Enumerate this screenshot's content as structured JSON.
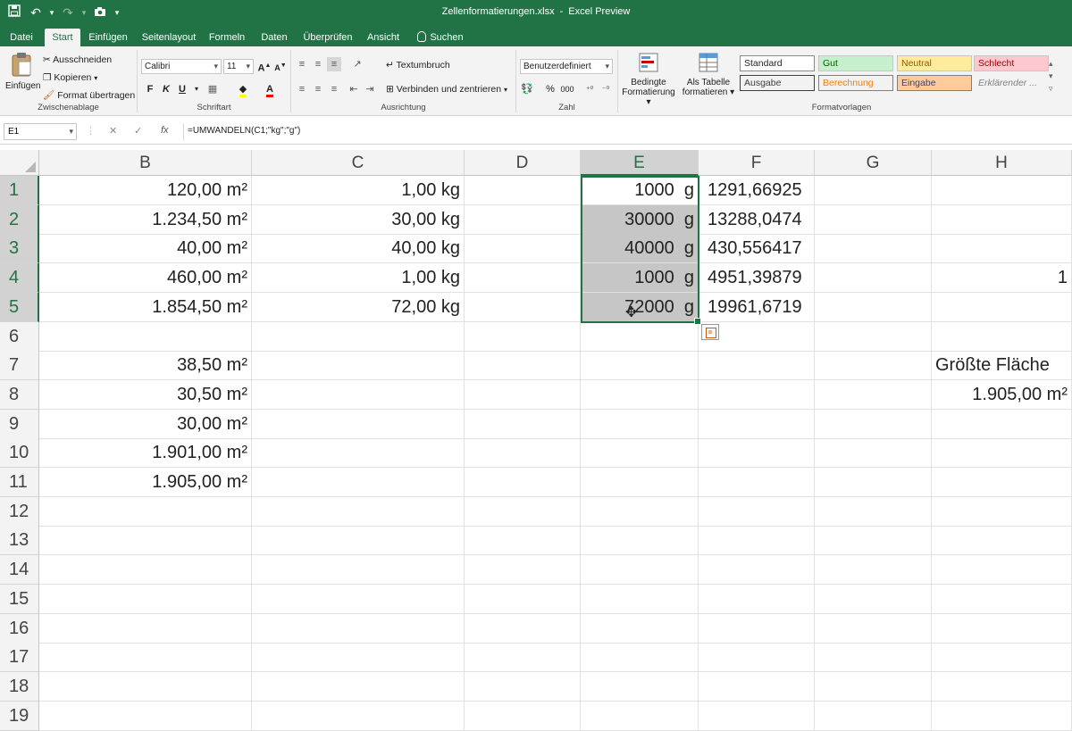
{
  "titlebar": {
    "file": "Zellenformatierungen.xlsx",
    "sep": "-",
    "app": "Excel Preview"
  },
  "tabs": [
    "Datei",
    "Start",
    "Einfügen",
    "Seitenlayout",
    "Formeln",
    "Daten",
    "Überprüfen",
    "Ansicht",
    "Suchen"
  ],
  "ribbon": {
    "clipboard": {
      "paste": "Einfügen",
      "cut": "Ausschneiden",
      "copy": "Kopieren",
      "painter": "Format übertragen",
      "label": "Zwischenablage"
    },
    "font": {
      "name": "Calibri",
      "size": "11",
      "bold": "F",
      "italic": "K",
      "underline": "U",
      "label": "Schriftart"
    },
    "alignment": {
      "wrap": "Textumbruch",
      "merge": "Verbinden und zentrieren",
      "label": "Ausrichtung"
    },
    "number": {
      "format": "Benutzerdefiniert",
      "percent": "%",
      "thousands": "000",
      "label": "Zahl"
    },
    "styles": {
      "conditional": [
        "Bedingte",
        "Formatierung"
      ],
      "table": [
        "Als Tabelle",
        "formatieren"
      ],
      "items": [
        {
          "label": "Standard",
          "bg": "#ffffff",
          "fg": "#222222",
          "border": "#8a8a8a"
        },
        {
          "label": "Gut",
          "bg": "#c6efce",
          "fg": "#006100",
          "border": "#c6c6c6"
        },
        {
          "label": "Neutral",
          "bg": "#ffeb9c",
          "fg": "#9c5700",
          "border": "#c6c6c6"
        },
        {
          "label": "Schlecht",
          "bg": "#ffc7ce",
          "fg": "#9c0006",
          "border": "#c6c6c6"
        },
        {
          "label": "Ausgabe",
          "bg": "#f2f2f2",
          "fg": "#3f3f3f",
          "border": "#3f3f3f"
        },
        {
          "label": "Berechnung",
          "bg": "#f2f2f2",
          "fg": "#fa7d00",
          "border": "#7f7f7f"
        },
        {
          "label": "Eingabe",
          "bg": "#ffcc99",
          "fg": "#3f3f76",
          "border": "#7f7f7f"
        },
        {
          "label": "Erklärender ...",
          "bg": "#f3f3f3",
          "fg": "#7f7f7f",
          "border": "#f3f3f3"
        }
      ],
      "label": "Formatvorlagen"
    }
  },
  "formula_bar": {
    "cell_ref": "E1",
    "cancel": "✕",
    "enter": "✓",
    "fx": "fx",
    "formula": "=UMWANDELN(C1;\"kg\";\"g\")"
  },
  "columns": [
    "B",
    "C",
    "D",
    "E",
    "F",
    "G",
    "H"
  ],
  "rows": [
    "1",
    "2",
    "3",
    "4",
    "5",
    "6",
    "7",
    "8",
    "9",
    "10",
    "11",
    "12",
    "13",
    "14",
    "15",
    "16",
    "17",
    "18",
    "19"
  ],
  "cells": {
    "B": [
      "120,00 m²",
      "1.234,50 m²",
      "40,00 m²",
      "460,00 m²",
      "1.854,50 m²",
      "",
      "38,50 m²",
      "30,50 m²",
      "30,00 m²",
      "1.901,00 m²",
      "1.905,00 m²"
    ],
    "C": [
      "1,00 kg",
      "30,00 kg",
      "40,00 kg",
      "1,00 kg",
      "72,00 kg"
    ],
    "E": [
      "1000  g",
      "30000  g",
      "40000  g",
      "1000  g",
      "72000  g"
    ],
    "F": [
      "1291,66925",
      "13288,0474",
      "430,556417",
      "4951,39879",
      "19961,6719"
    ],
    "H": [
      "",
      "",
      "",
      "1",
      "",
      "",
      "Größte Fläche",
      "1.905,00 m²"
    ]
  },
  "colors": {
    "accent": "#217346"
  }
}
